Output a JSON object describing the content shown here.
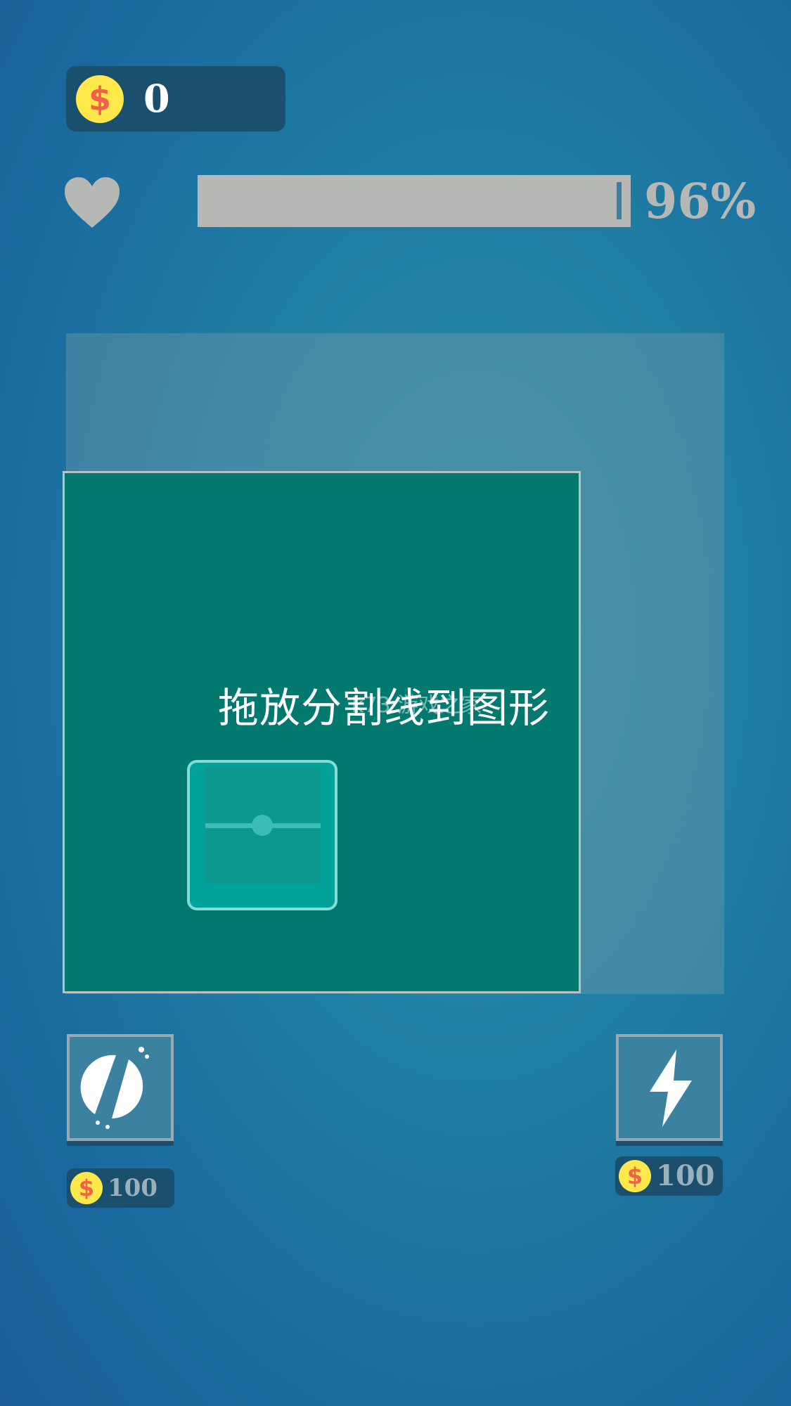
{
  "hud": {
    "coins": "0",
    "coin_symbol": "$",
    "health_percent_label": "96%",
    "health_value": 0.96
  },
  "board": {
    "instruction": "拖放分割线到图形",
    "watermark": "k73 游戏之家"
  },
  "tools": {
    "left": {
      "icon": "cut-circle-icon",
      "price": "100"
    },
    "right": {
      "icon": "lightning-icon",
      "price": "100"
    }
  },
  "colors": {
    "background": "#1f7ea3",
    "main_shape": "#02796e",
    "divider_tile": "#00a29a",
    "coin": "#ffe84a",
    "health_bar": "#b5b8b5"
  }
}
